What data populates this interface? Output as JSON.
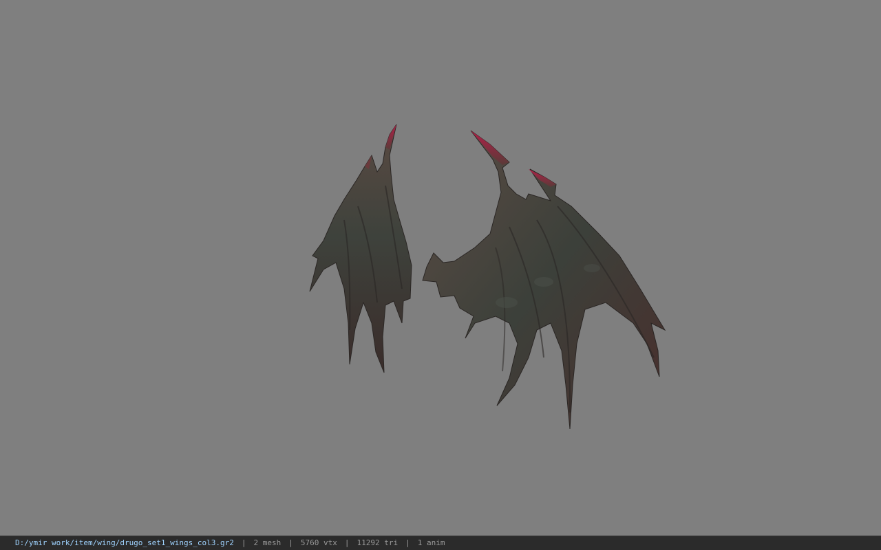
{
  "viewport": {
    "background_color": "#7f7f7f",
    "model_description": "dark bat-like wings with red tips"
  },
  "status_bar": {
    "file_path": "D:/ymir work/item/wing/drugo_set1_wings_col3.gr2",
    "separator": "|",
    "mesh_count": "2 mesh",
    "vertex_count": "5760 vtx",
    "triangle_count": "11292 tri",
    "anim_count": "1 anim",
    "path_color": "#9fd3ff",
    "stat_color": "#9a9a9a"
  }
}
